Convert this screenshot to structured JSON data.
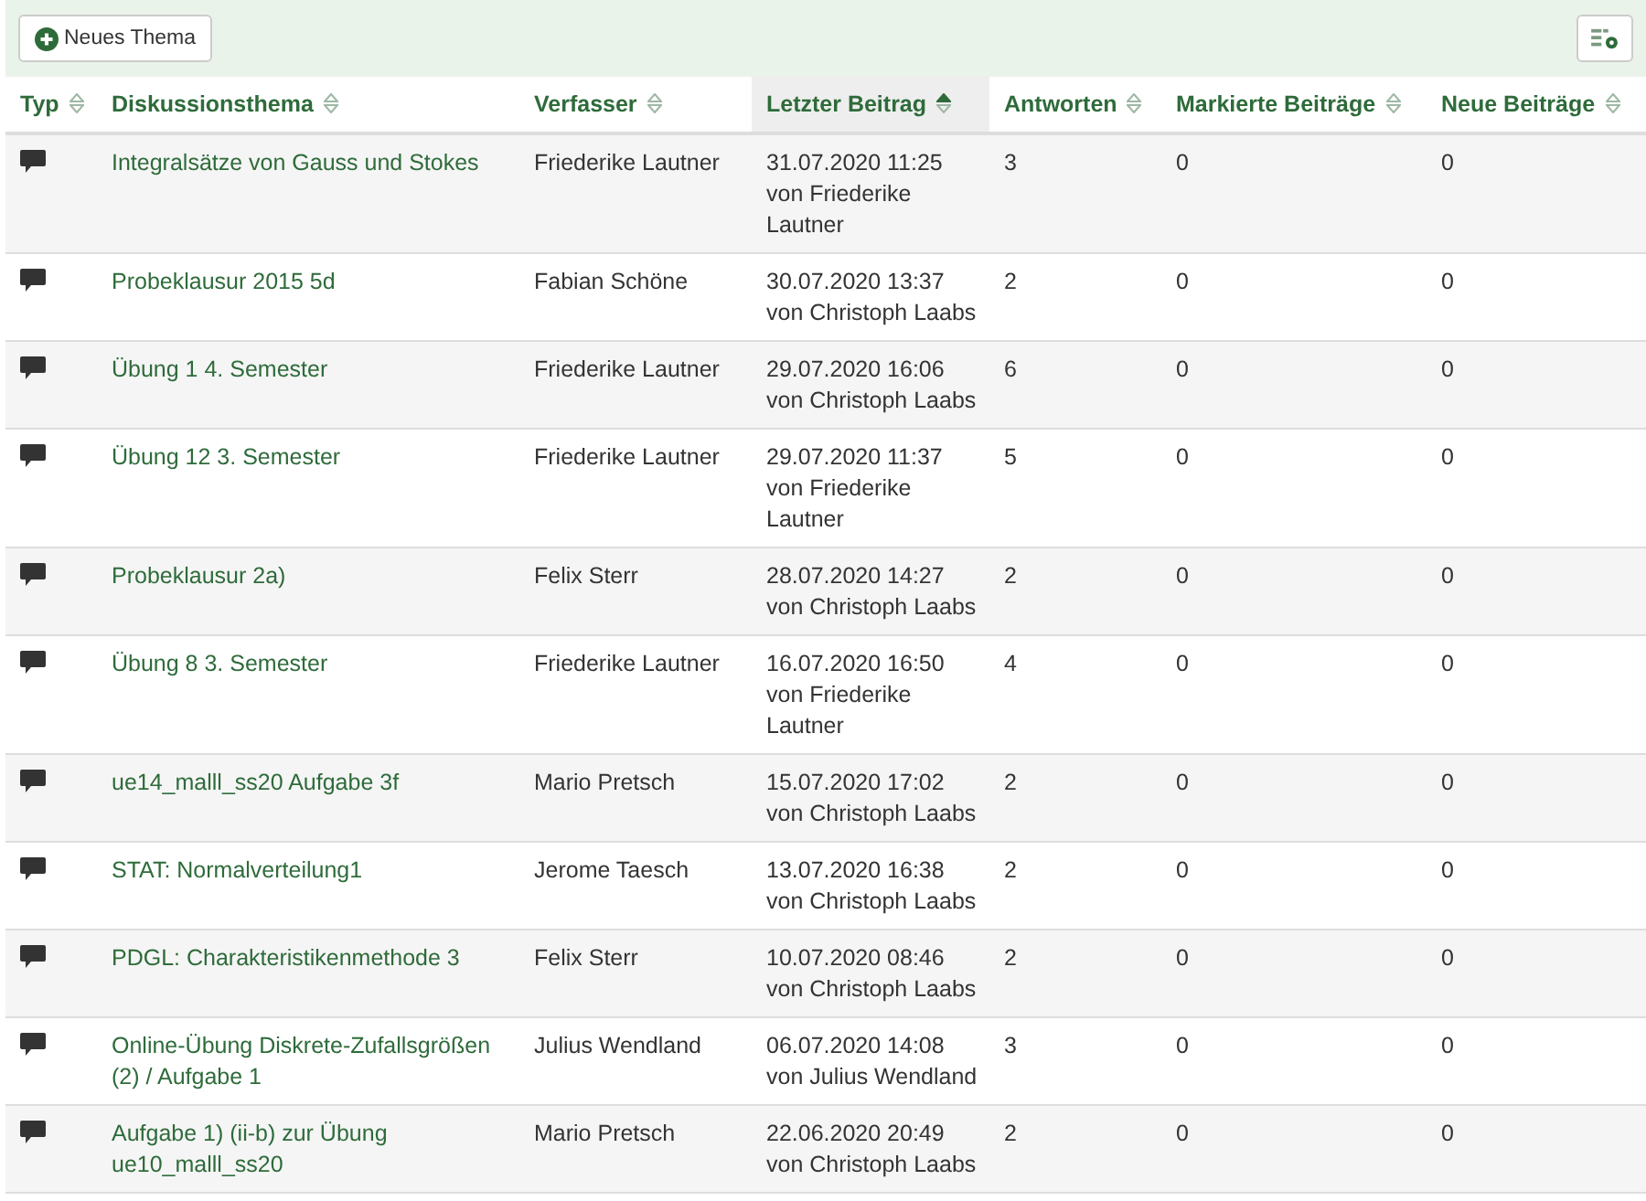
{
  "toolbar": {
    "new_button": "Neues Thema"
  },
  "table": {
    "columns": [
      {
        "label": "Typ",
        "sorted": false
      },
      {
        "label": "Diskussionsthema",
        "sorted": false
      },
      {
        "label": "Verfasser",
        "sorted": false
      },
      {
        "label": "Letzter Beitrag",
        "sorted": true
      },
      {
        "label": "Antworten",
        "sorted": false
      },
      {
        "label": "Markierte Beiträge",
        "sorted": false
      },
      {
        "label": "Neue Beiträge",
        "sorted": false
      }
    ],
    "rows": [
      {
        "topic": "Integralsätze von Gauss und Stokes",
        "author": "Friederike Lautner",
        "last_date": "31.07.2020 11:25",
        "last_by": "von Friederike Lautner",
        "answers": "3",
        "marked": "0",
        "new": "0"
      },
      {
        "topic": "Probeklausur 2015 5d",
        "author": "Fabian Schöne",
        "last_date": "30.07.2020 13:37",
        "last_by": "von Christoph Laabs",
        "answers": "2",
        "marked": "0",
        "new": "0"
      },
      {
        "topic": "Übung 1 4. Semester",
        "author": "Friederike Lautner",
        "last_date": "29.07.2020 16:06",
        "last_by": "von Christoph Laabs",
        "answers": "6",
        "marked": "0",
        "new": "0"
      },
      {
        "topic": "Übung 12 3. Semester",
        "author": "Friederike Lautner",
        "last_date": "29.07.2020 11:37",
        "last_by": "von Friederike Lautner",
        "answers": "5",
        "marked": "0",
        "new": "0"
      },
      {
        "topic": "Probeklausur 2a)",
        "author": "Felix Sterr",
        "last_date": "28.07.2020 14:27",
        "last_by": "von Christoph Laabs",
        "answers": "2",
        "marked": "0",
        "new": "0"
      },
      {
        "topic": "Übung 8 3. Semester",
        "author": "Friederike Lautner",
        "last_date": "16.07.2020 16:50",
        "last_by": "von Friederike Lautner",
        "answers": "4",
        "marked": "0",
        "new": "0"
      },
      {
        "topic": "ue14_malll_ss20 Aufgabe 3f",
        "author": "Mario Pretsch",
        "last_date": "15.07.2020 17:02",
        "last_by": "von Christoph Laabs",
        "answers": "2",
        "marked": "0",
        "new": "0"
      },
      {
        "topic": "STAT: Normalverteilung1",
        "author": "Jerome Taesch",
        "last_date": "13.07.2020 16:38",
        "last_by": "von Christoph Laabs",
        "answers": "2",
        "marked": "0",
        "new": "0"
      },
      {
        "topic": "PDGL: Charakteristikenmethode 3",
        "author": "Felix Sterr",
        "last_date": "10.07.2020 08:46",
        "last_by": "von Christoph Laabs",
        "answers": "2",
        "marked": "0",
        "new": "0"
      },
      {
        "topic": "Online-Übung Diskrete-Zufallsgrößen (2) / Aufgabe 1",
        "author": "Julius Wendland",
        "last_date": "06.07.2020 14:08",
        "last_by": "von Julius Wendland",
        "answers": "3",
        "marked": "0",
        "new": "0"
      },
      {
        "topic": "Aufgabe  1) (ii-b) zur Übung ue10_malll_ss20",
        "author": "Mario Pretsch",
        "last_date": "22.06.2020 20:49",
        "last_by": "von Christoph Laabs",
        "answers": "2",
        "marked": "0",
        "new": "0"
      }
    ]
  }
}
